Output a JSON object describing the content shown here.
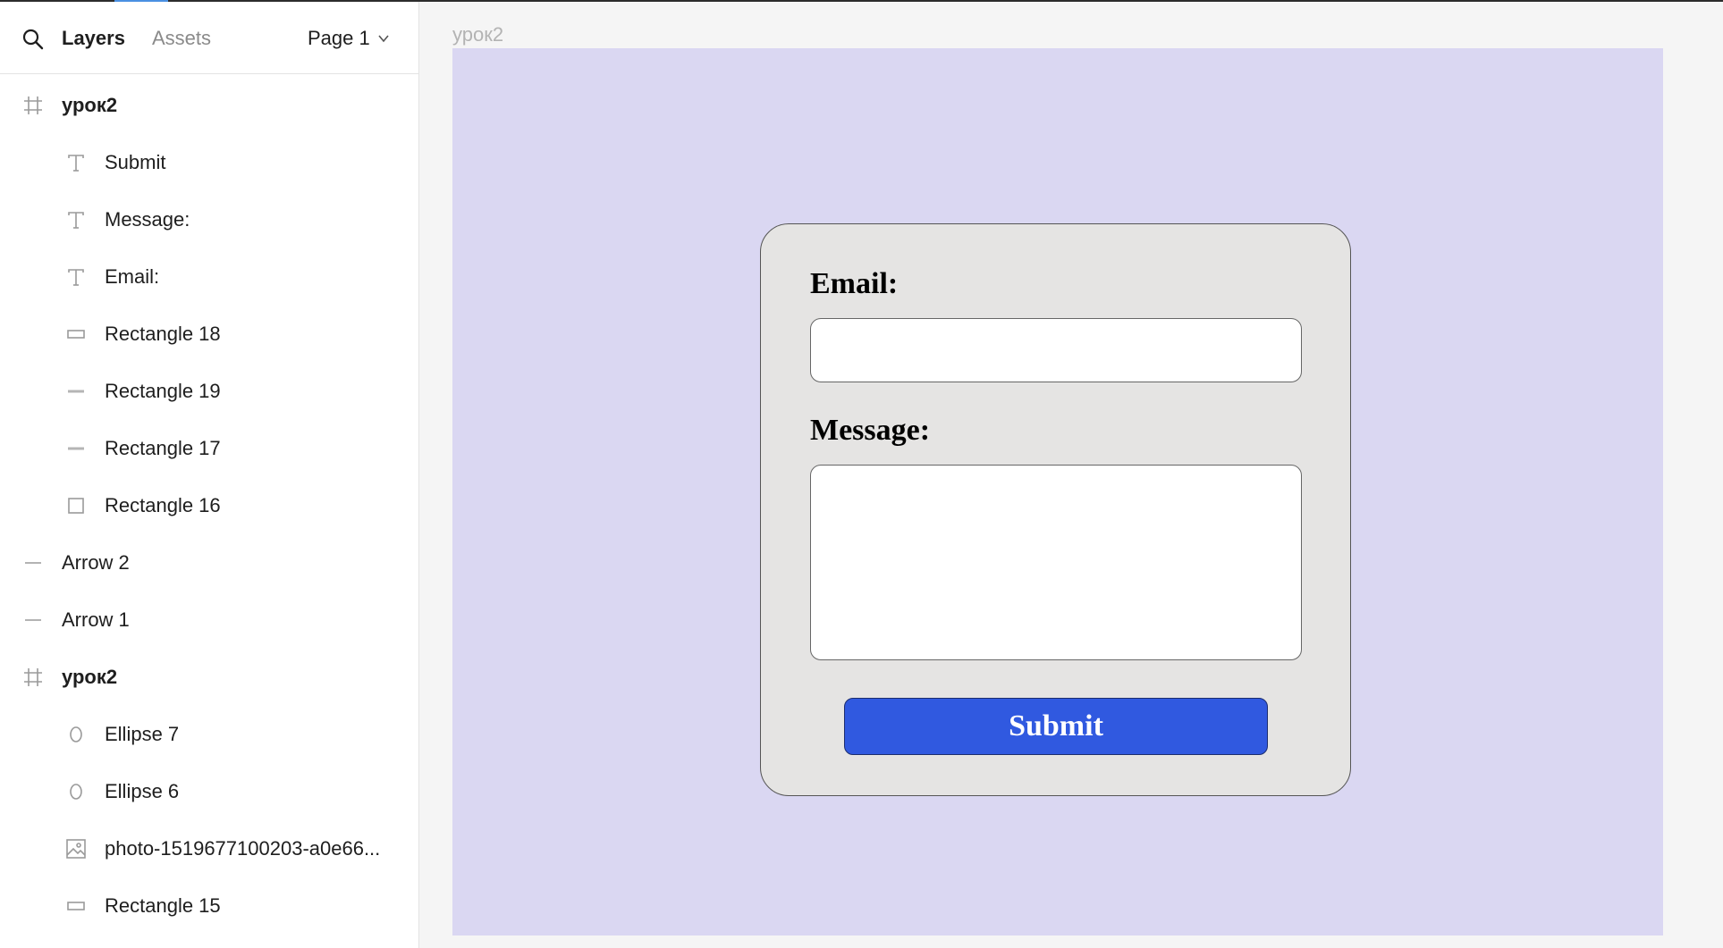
{
  "sidebar": {
    "tabs": {
      "layers": "Layers",
      "assets": "Assets"
    },
    "page_select": "Page 1",
    "layers": [
      {
        "label": "урок2",
        "icon": "frame-icon",
        "level": 0,
        "frame": true
      },
      {
        "label": "Submit",
        "icon": "text-icon",
        "level": 1
      },
      {
        "label": "Message:",
        "icon": "text-icon",
        "level": 1
      },
      {
        "label": "Email:",
        "icon": "text-icon",
        "level": 1
      },
      {
        "label": "Rectangle 18",
        "icon": "rectangle-icon",
        "level": 1
      },
      {
        "label": "Rectangle 19",
        "icon": "line-rectangle-icon",
        "level": 1
      },
      {
        "label": "Rectangle 17",
        "icon": "line-rectangle-icon",
        "level": 1
      },
      {
        "label": "Rectangle 16",
        "icon": "square-icon",
        "level": 1
      },
      {
        "label": "Arrow 2",
        "icon": "line-icon",
        "level": 0
      },
      {
        "label": "Arrow 1",
        "icon": "line-icon",
        "level": 0
      },
      {
        "label": "урок2",
        "icon": "frame-icon",
        "level": 0,
        "frame": true
      },
      {
        "label": "Ellipse 7",
        "icon": "ellipse-icon",
        "level": 1
      },
      {
        "label": "Ellipse 6",
        "icon": "ellipse-icon",
        "level": 1
      },
      {
        "label": "photo-1519677100203-a0e66...",
        "icon": "image-icon",
        "level": 1
      },
      {
        "label": "Rectangle 15",
        "icon": "rectangle-icon",
        "level": 1
      }
    ]
  },
  "canvas": {
    "frame_title": "урок2",
    "form": {
      "email_label": "Email:",
      "message_label": "Message:",
      "submit_label": "Submit"
    }
  },
  "colors": {
    "frame_background": "#dad7f2",
    "card_background": "#e5e4e3",
    "submit_button": "#3059e0",
    "canvas_background": "#f5f5f5"
  }
}
